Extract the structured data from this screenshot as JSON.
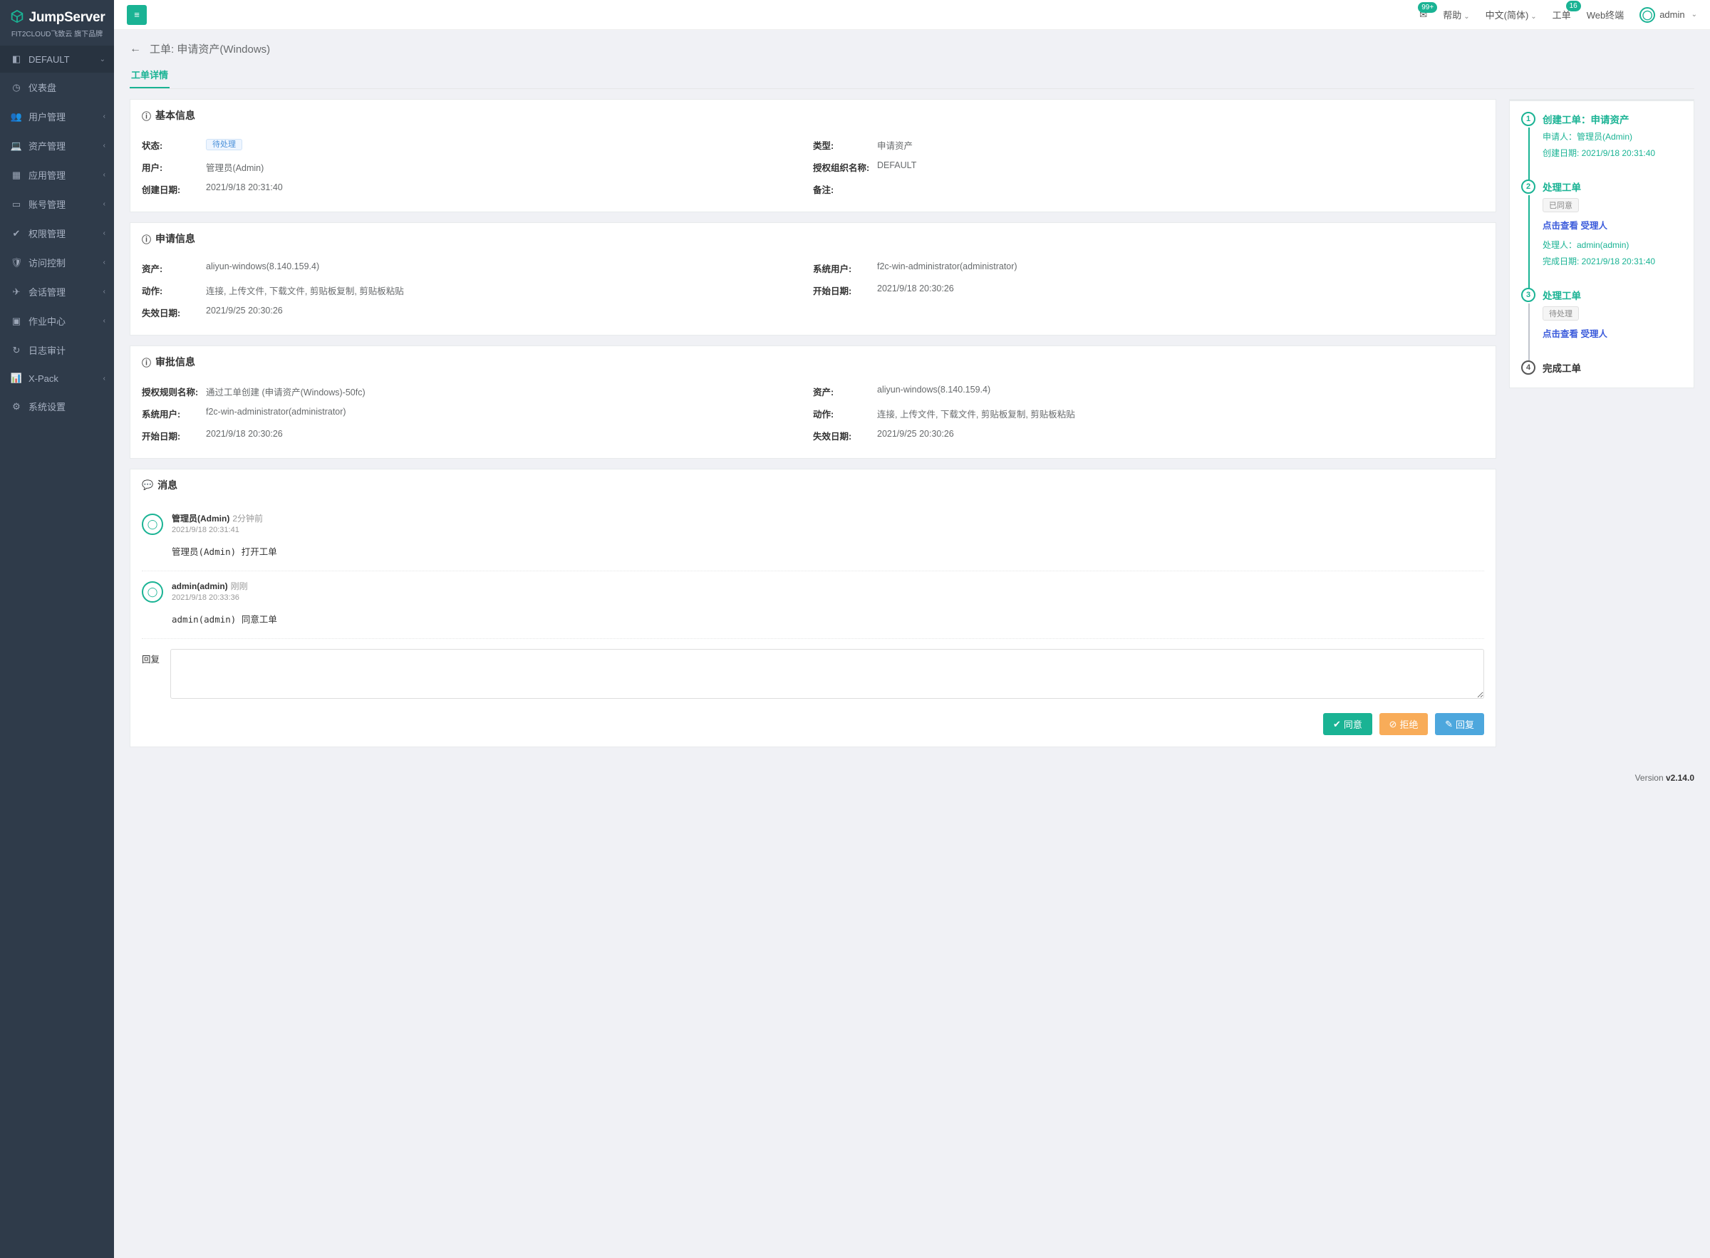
{
  "brand": {
    "name": "JumpServer",
    "sub": "FIT2CLOUD飞致云 旗下品牌"
  },
  "sidebar": {
    "org": "DEFAULT",
    "items": [
      {
        "label": "仪表盘"
      },
      {
        "label": "用户管理",
        "chev": true
      },
      {
        "label": "资产管理",
        "chev": true
      },
      {
        "label": "应用管理",
        "chev": true
      },
      {
        "label": "账号管理",
        "chev": true
      },
      {
        "label": "权限管理",
        "chev": true
      },
      {
        "label": "访问控制",
        "chev": true
      },
      {
        "label": "会话管理",
        "chev": true
      },
      {
        "label": "作业中心",
        "chev": true
      },
      {
        "label": "日志审计"
      },
      {
        "label": "X-Pack",
        "chev": true
      },
      {
        "label": "系统设置"
      }
    ]
  },
  "topbar": {
    "mail_badge": "99+",
    "help": "帮助",
    "lang": "中文(简体)",
    "tickets": "工单",
    "tickets_badge": "16",
    "webterm": "Web终端",
    "user": "admin"
  },
  "page": {
    "title": "工单: 申请资产(Windows)",
    "tab": "工单详情"
  },
  "basic": {
    "title": "基本信息",
    "status_label": "状态:",
    "status_chip": "待处理",
    "type_label": "类型:",
    "type_value": "申请资产",
    "user_label": "用户:",
    "user_value": "管理员(Admin)",
    "org_label": "授权组织名称:",
    "org_value": "DEFAULT",
    "created_label": "创建日期:",
    "created_value": "2021/9/18 20:31:40",
    "remark_label": "备注:",
    "remark_value": ""
  },
  "apply": {
    "title": "申请信息",
    "asset_label": "资产:",
    "asset_value": "aliyun-windows(8.140.159.4)",
    "sysuser_label": "系统用户:",
    "sysuser_value": "f2c-win-administrator(administrator)",
    "action_label": "动作:",
    "action_value": "连接, 上传文件, 下载文件, 剪贴板复制, 剪贴板粘贴",
    "start_label": "开始日期:",
    "start_value": "2021/9/18 20:30:26",
    "expire_label": "失效日期:",
    "expire_value": "2021/9/25 20:30:26"
  },
  "approve": {
    "title": "审批信息",
    "rule_label": "授权规则名称:",
    "rule_value": "通过工单创建 (申请资产(Windows)-50fc)",
    "asset_label": "资产:",
    "asset_value": "aliyun-windows(8.140.159.4)",
    "sysuser_label": "系统用户:",
    "sysuser_value": "f2c-win-administrator(administrator)",
    "action_label": "动作:",
    "action_value": "连接, 上传文件, 下载文件, 剪贴板复制, 剪贴板粘贴",
    "start_label": "开始日期:",
    "start_value": "2021/9/18 20:30:26",
    "expire_label": "失效日期:",
    "expire_value": "2021/9/25 20:30:26"
  },
  "messages": {
    "title": "消息",
    "items": [
      {
        "name": "管理员(Admin)",
        "rel": "2分钟前",
        "ts": "2021/9/18 20:31:41",
        "body_code": "管理员(Admin)",
        "body_tail": "打开工单"
      },
      {
        "name": "admin(admin)",
        "rel": "刚刚",
        "ts": "2021/9/18 20:33:36",
        "body_code": "admin(admin)",
        "body_tail": "同意工单"
      }
    ],
    "reply_label": "回复"
  },
  "actions": {
    "approve": "同意",
    "reject": "拒绝",
    "reply": "回复"
  },
  "timeline": {
    "step1": {
      "num": "1",
      "title": "创建工单：申请资产",
      "line1": "申请人：管理员(Admin)",
      "line2": "创建日期: 2021/9/18 20:31:40"
    },
    "step2": {
      "num": "2",
      "title": "处理工单",
      "chip": "已同意",
      "link": "点击查看 受理人",
      "line1": "处理人：admin(admin)",
      "line2": "完成日期: 2021/9/18 20:31:40"
    },
    "step3": {
      "num": "3",
      "title": "处理工单",
      "chip": "待处理",
      "link": "点击查看 受理人"
    },
    "step4": {
      "num": "4",
      "title": "完成工单"
    }
  },
  "footer": {
    "prefix": "Version ",
    "version": "v2.14.0"
  }
}
